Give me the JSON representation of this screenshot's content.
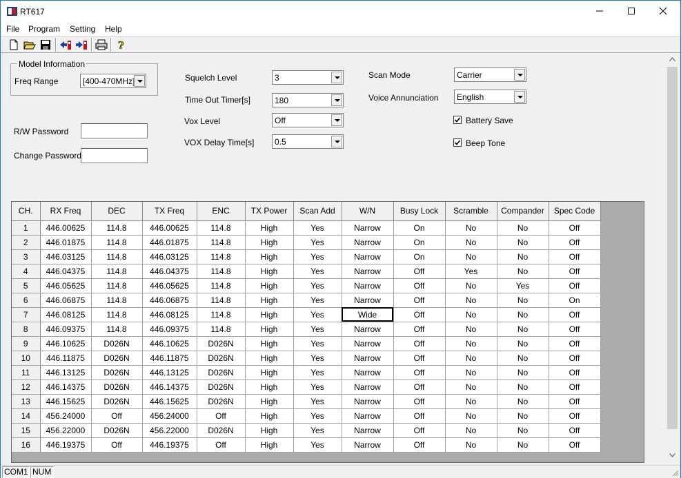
{
  "window": {
    "title": "RT617",
    "controls": {
      "minimize": "minimize-icon",
      "maximize": "maximize-icon",
      "close": "close-icon"
    }
  },
  "menu": [
    "File",
    "Program",
    "Setting",
    "Help"
  ],
  "toolbar": [
    "new-file-icon",
    "open-folder-icon",
    "save-icon",
    "read-from-radio-icon",
    "write-to-radio-icon",
    "print-icon",
    "help-icon"
  ],
  "model_info": {
    "legend": "Model Information",
    "freq_range_label": "Freq Range",
    "freq_range_value": "[400-470MHz]"
  },
  "password": {
    "rw_label": "R/W Password",
    "rw_value": "",
    "change_label": "Change Password",
    "change_value": ""
  },
  "settings": {
    "squelch_label": "Squelch Level",
    "squelch_value": "3",
    "tot_label": "Time Out Timer[s]",
    "tot_value": "180",
    "vox_label": "Vox Level",
    "vox_value": "Off",
    "vox_delay_label": "VOX Delay Time[s]",
    "vox_delay_value": "0.5",
    "scan_mode_label": "Scan Mode",
    "scan_mode_value": "Carrier",
    "voice_label": "Voice Annunciation",
    "voice_value": "English",
    "battery_save_label": "Battery Save",
    "battery_save_checked": true,
    "beep_tone_label": "Beep Tone",
    "beep_tone_checked": true
  },
  "grid": {
    "columns": [
      "CH.",
      "RX Freq",
      "DEC",
      "TX Freq",
      "ENC",
      "TX Power",
      "Scan Add",
      "W/N",
      "Busy Lock",
      "Scramble",
      "Compander",
      "Spec Code"
    ],
    "rows": [
      [
        "1",
        "446.00625",
        "114.8",
        "446.00625",
        "114.8",
        "High",
        "Yes",
        "Narrow",
        "On",
        "No",
        "No",
        "Off"
      ],
      [
        "2",
        "446.01875",
        "114.8",
        "446.01875",
        "114.8",
        "High",
        "Yes",
        "Narrow",
        "On",
        "No",
        "No",
        "Off"
      ],
      [
        "3",
        "446.03125",
        "114.8",
        "446.03125",
        "114.8",
        "High",
        "Yes",
        "Narrow",
        "On",
        "No",
        "No",
        "Off"
      ],
      [
        "4",
        "446.04375",
        "114.8",
        "446.04375",
        "114.8",
        "High",
        "Yes",
        "Narrow",
        "Off",
        "Yes",
        "No",
        "Off"
      ],
      [
        "5",
        "446.05625",
        "114.8",
        "446.05625",
        "114.8",
        "High",
        "Yes",
        "Narrow",
        "Off",
        "No",
        "Yes",
        "Off"
      ],
      [
        "6",
        "446.06875",
        "114.8",
        "446.06875",
        "114.8",
        "High",
        "Yes",
        "Narrow",
        "Off",
        "No",
        "No",
        "On"
      ],
      [
        "7",
        "446.08125",
        "114.8",
        "446.08125",
        "114.8",
        "High",
        "Yes",
        "Wide",
        "Off",
        "No",
        "No",
        "Off"
      ],
      [
        "8",
        "446.09375",
        "114.8",
        "446.09375",
        "114.8",
        "High",
        "Yes",
        "Narrow",
        "Off",
        "No",
        "No",
        "Off"
      ],
      [
        "9",
        "446.10625",
        "D026N",
        "446.10625",
        "D026N",
        "High",
        "Yes",
        "Narrow",
        "Off",
        "No",
        "No",
        "Off"
      ],
      [
        "10",
        "446.11875",
        "D026N",
        "446.11875",
        "D026N",
        "High",
        "Yes",
        "Narrow",
        "Off",
        "No",
        "No",
        "Off"
      ],
      [
        "11",
        "446.13125",
        "D026N",
        "446.13125",
        "D026N",
        "High",
        "Yes",
        "Narrow",
        "Off",
        "No",
        "No",
        "Off"
      ],
      [
        "12",
        "446.14375",
        "D026N",
        "446.14375",
        "D026N",
        "High",
        "Yes",
        "Narrow",
        "Off",
        "No",
        "No",
        "Off"
      ],
      [
        "13",
        "446.15625",
        "D026N",
        "446.15625",
        "D026N",
        "High",
        "Yes",
        "Narrow",
        "Off",
        "No",
        "No",
        "Off"
      ],
      [
        "14",
        "456.24000",
        "Off",
        "456.24000",
        "Off",
        "High",
        "Yes",
        "Narrow",
        "Off",
        "No",
        "No",
        "Off"
      ],
      [
        "15",
        "456.22000",
        "D026N",
        "456.22000",
        "D026N",
        "High",
        "Yes",
        "Narrow",
        "Off",
        "No",
        "No",
        "Off"
      ],
      [
        "16",
        "446.19375",
        "Off",
        "446.19375",
        "Off",
        "High",
        "Yes",
        "Narrow",
        "Off",
        "No",
        "No",
        "Off"
      ]
    ],
    "selected_cell": {
      "row": 6,
      "col": 7
    }
  },
  "status": [
    "COM1",
    "NUM"
  ]
}
